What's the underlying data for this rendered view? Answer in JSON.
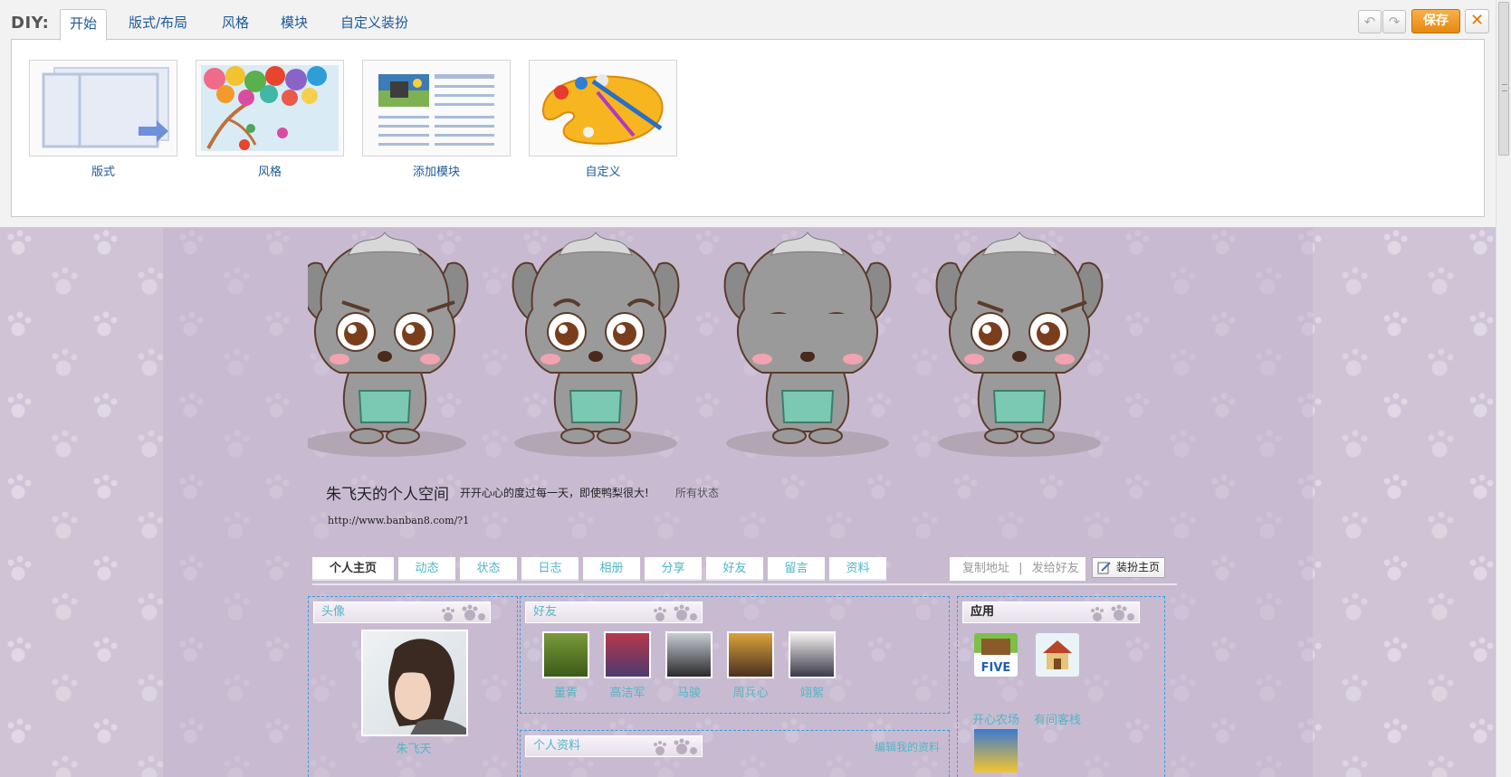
{
  "diy": {
    "label": "DIY:",
    "tabs": [
      {
        "label": "开始"
      },
      {
        "label": "版式/布局"
      },
      {
        "label": "风格"
      },
      {
        "label": "模块"
      },
      {
        "label": "自定义装扮"
      }
    ],
    "items": [
      {
        "label": "版式",
        "icon": "layout-icon"
      },
      {
        "label": "风格",
        "icon": "style-icon"
      },
      {
        "label": "添加模块",
        "icon": "add-module-icon"
      },
      {
        "label": "自定义",
        "icon": "palette-icon"
      }
    ],
    "save_label": "保存",
    "close_glyph": "✕",
    "undo_glyph": "↶",
    "redo_glyph": "↷"
  },
  "space": {
    "title": "朱飞天的个人空间",
    "motto": "开开心心的度过每一天，即使鸭梨很大!",
    "status_link": "所有状态",
    "url": "http://www.banban8.com/?1",
    "nav": [
      "个人主页",
      "动态",
      "状态",
      "日志",
      "相册",
      "分享",
      "好友",
      "留言",
      "资料"
    ],
    "nav_current": "个人主页",
    "share": {
      "copy_address": "复制地址",
      "separator": "|",
      "send_friend": "发给好友"
    },
    "decorate_label": "装扮主页"
  },
  "modules": {
    "avatar": {
      "title": "头像",
      "name": "朱飞天"
    },
    "friends": {
      "title": "好友",
      "list": [
        "董胥",
        "高洁军",
        "马骏",
        "周兵心",
        "翊絮"
      ]
    },
    "profile": {
      "title": "个人资料",
      "edit_link": "编辑我的资料"
    },
    "apps": {
      "title": "应用",
      "list": [
        "开心农场",
        "有间客栈"
      ]
    }
  },
  "colors": {
    "accent": "#52b5c5",
    "link_blue": "#1c5a99",
    "save_orange": "#e48a10",
    "page_bg": "#cfc3d6"
  }
}
